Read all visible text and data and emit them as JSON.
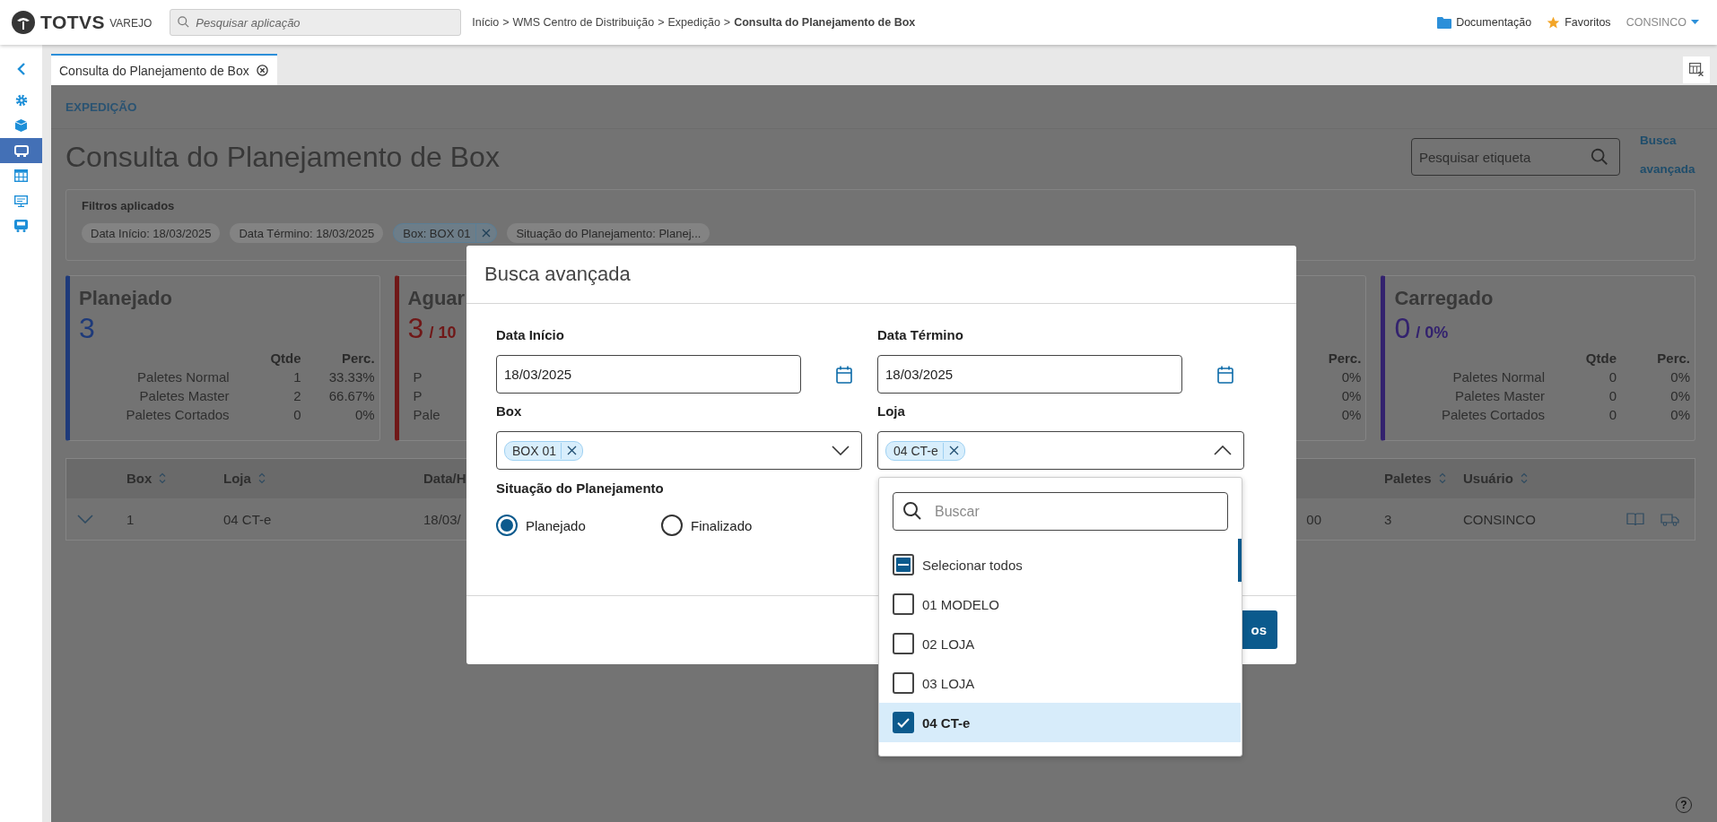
{
  "header": {
    "brand": "TOTVS",
    "product": "VAREJO",
    "search_placeholder": "Pesquisar aplicação",
    "breadcrumb_separator": ">",
    "breadcrumb": [
      {
        "label": "Início",
        "current": false
      },
      {
        "label": "WMS Centro de Distribuição",
        "current": false
      },
      {
        "label": "Expedição",
        "current": false
      },
      {
        "label": "Consulta do Planejamento de Box",
        "current": true
      }
    ],
    "links": [
      "Documentação",
      "Favoritos"
    ],
    "user": "CONSINCO"
  },
  "sidebar": {
    "items": [
      {
        "selected": false
      },
      {
        "selected": false
      },
      {
        "selected": true
      },
      {
        "selected": false
      },
      {
        "selected": false
      },
      {
        "selected": false
      }
    ]
  },
  "tabs": [
    {
      "label": "Consulta do Planejamento de Box",
      "selected": true
    }
  ],
  "page": {
    "section": "EXPEDIÇÃO",
    "title": "Consulta do Planejamento de Box",
    "search_placeholder": "Pesquisar etiqueta",
    "advanced_link": "Busca avançada"
  },
  "filters": {
    "title": "Filtros aplicados",
    "chips": [
      {
        "label": "Data Início: 18/03/2025",
        "removable": false
      },
      {
        "label": "Data Término: 18/03/2025",
        "removable": false
      },
      {
        "label": "Box: BOX 01",
        "removable": true
      },
      {
        "label": "Situação do Planejamento: Planej...",
        "removable": false
      }
    ]
  },
  "cards": [
    {
      "title": "Planejado",
      "value": "3",
      "color": "#1e3a7a",
      "header": {
        "qtde": "Qtde",
        "perc": "Perc."
      },
      "rows": [
        {
          "label": "Paletes Normal",
          "qtde": "1",
          "perc": "33.33%"
        },
        {
          "label": "Paletes Master",
          "qtde": "2",
          "perc": "66.67%"
        },
        {
          "label": "Paletes Cortados",
          "qtde": "0",
          "perc": "0%"
        }
      ]
    },
    {
      "title": "Aguar",
      "value": "3",
      "suffix": "/ 10",
      "color": "#701818",
      "rows": [
        {
          "label": "P"
        },
        {
          "label": "P"
        },
        {
          "label": "Pale"
        }
      ]
    },
    {
      "header": {
        "perc": "Perc."
      },
      "rows": [
        {
          "perc": "0%"
        },
        {
          "perc": "0%"
        },
        {
          "perc": "0%"
        }
      ]
    },
    {
      "title": "Carregado",
      "value": "0",
      "suffix": "/ 0%",
      "color": "#33226e",
      "header": {
        "qtde": "Qtde",
        "perc": "Perc."
      },
      "rows": [
        {
          "label": "Paletes Normal",
          "qtde": "0",
          "perc": "0%"
        },
        {
          "label": "Paletes Master",
          "qtde": "0",
          "perc": "0%"
        },
        {
          "label": "Paletes Cortados",
          "qtde": "0",
          "perc": "0%"
        }
      ]
    }
  ],
  "table": {
    "columns": [
      {
        "label": "Box",
        "sortable": true
      },
      {
        "label": "Loja",
        "sortable": true
      },
      {
        "label": "Data/H"
      },
      {},
      {
        "label": "Paletes",
        "sortable": true
      },
      {
        "label": "Usuário",
        "sortable": true
      }
    ],
    "rows": [
      {
        "expanded": false,
        "cells": [
          "1",
          "04 CT-e",
          "18/03/",
          "00",
          "3",
          "CONSINCO"
        ]
      }
    ]
  },
  "help": "?",
  "modal": {
    "title": "Busca avançada",
    "fields": [
      {
        "kind": "date",
        "label": "Data Início",
        "value": "18/03/2025"
      },
      {
        "kind": "date",
        "label": "Data Término",
        "value": "18/03/2025"
      },
      {
        "kind": "select",
        "label": "Box",
        "tags": [
          "BOX 01"
        ],
        "expanded": false
      },
      {
        "kind": "select",
        "label": "Loja",
        "tags": [
          "04 CT-e"
        ],
        "expanded": true
      }
    ],
    "radio_group": {
      "label": "Situação do Planejamento",
      "options": [
        {
          "label": "Planejado",
          "selected": true
        },
        {
          "label": "Finalizado",
          "selected": false
        }
      ]
    },
    "button": "os",
    "dropdown": {
      "search_placeholder": "Buscar",
      "options": [
        {
          "label": "Selecionar todos",
          "checked": false,
          "indeterminate": true,
          "selected": false
        },
        {
          "label": "01 MODELO",
          "checked": false,
          "selected": false
        },
        {
          "label": "02 LOJA",
          "checked": false,
          "selected": false
        },
        {
          "label": "03 LOJA",
          "checked": false,
          "selected": false
        },
        {
          "label": "04 CT-e",
          "checked": true,
          "selected": true
        }
      ]
    }
  }
}
